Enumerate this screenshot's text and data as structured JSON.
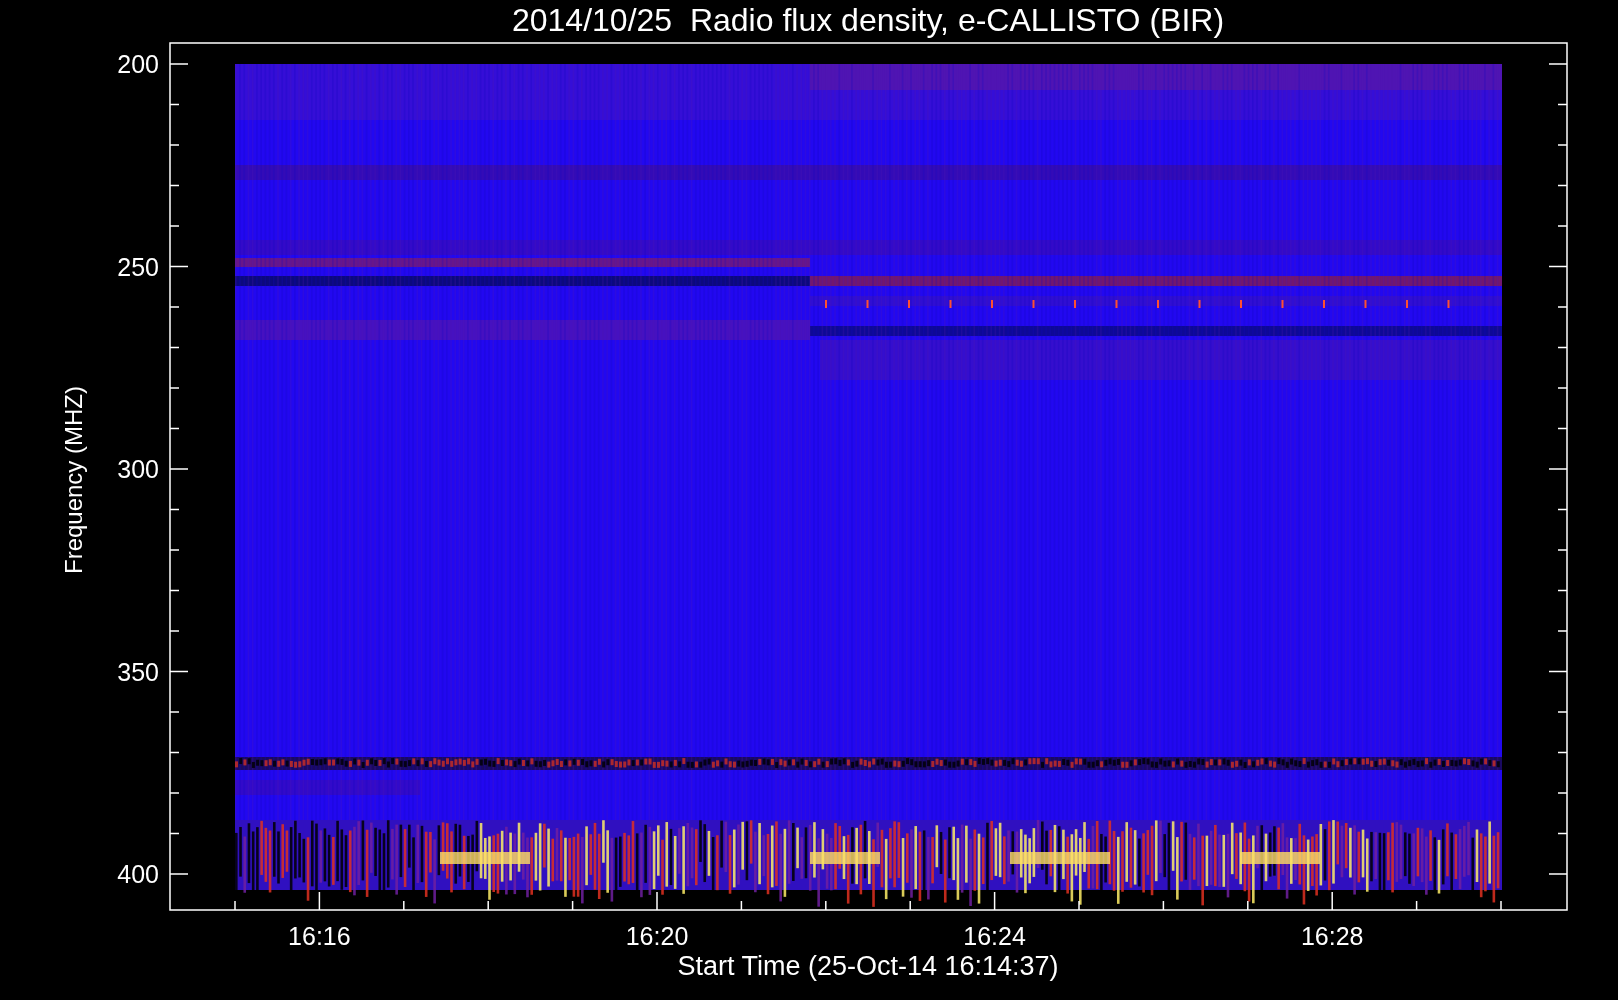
{
  "title": "2014/10/25  Radio flux density, e-CALLISTO (BIR)",
  "y_axis": {
    "label": "Frequency (MHZ)",
    "ticks": [
      "200",
      "250",
      "300",
      "350",
      "400"
    ]
  },
  "x_axis": {
    "label": "Start Time (25-Oct-14 16:14:37)",
    "ticks": [
      "16:16",
      "16:20",
      "16:24",
      "16:28"
    ]
  }
}
